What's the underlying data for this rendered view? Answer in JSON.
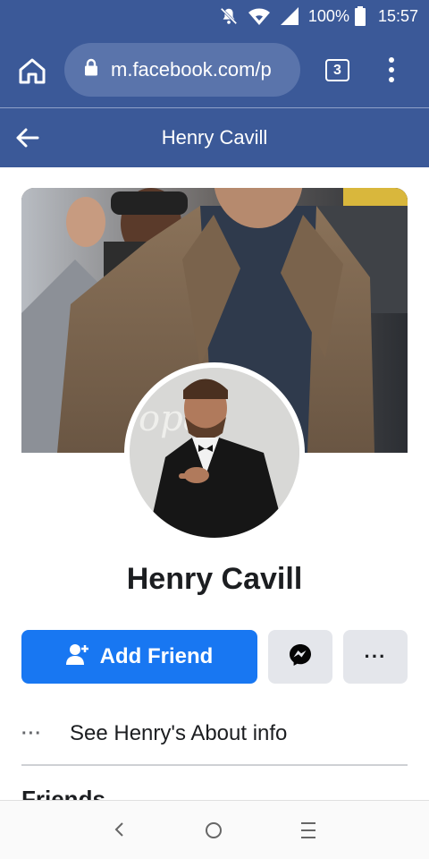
{
  "status_bar": {
    "battery": "100%",
    "time": "15:57"
  },
  "browser": {
    "url": "m.facebook.com/p",
    "tab_count": "3"
  },
  "header": {
    "title": "Henry Cavill"
  },
  "profile": {
    "name": "Henry Cavill",
    "add_friend_label": "Add Friend",
    "more_label": "···",
    "about_text": "See Henry's About info",
    "about_dots": "···",
    "friends_heading": "Friends"
  },
  "colors": {
    "brand_blue": "#3b5998",
    "button_blue": "#1877f2",
    "button_gray": "#e4e6eb"
  }
}
